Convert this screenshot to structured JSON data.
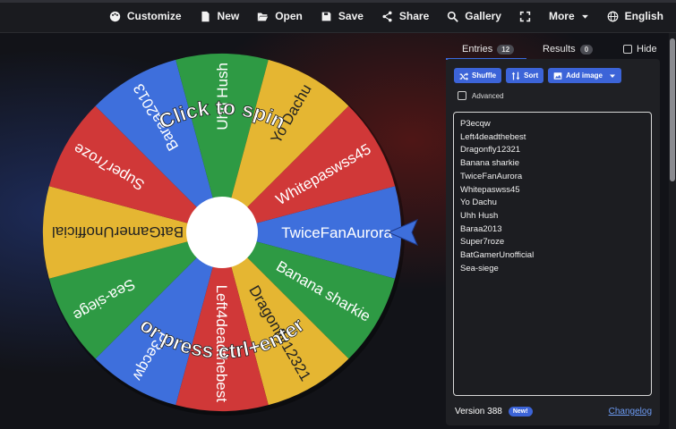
{
  "toolbar": {
    "customize": "Customize",
    "new": "New",
    "open": "Open",
    "save": "Save",
    "share": "Share",
    "gallery": "Gallery",
    "more": "More",
    "language": "English"
  },
  "wheel": {
    "prompt_top": "Click to spin",
    "prompt_bottom": "or press ctrl+enter",
    "segments": [
      {
        "label": "TwiceFanAurora",
        "color": "#3e6fdc"
      },
      {
        "label": "Banana sharkie",
        "color": "#2e9a44"
      },
      {
        "label": "Dragonfly12321",
        "color": "#e5b632"
      },
      {
        "label": "Left4deadthebest",
        "color": "#d03838"
      },
      {
        "label": "P3ecqw",
        "color": "#3e6fdc"
      },
      {
        "label": "Sea-siege",
        "color": "#2e9a44"
      },
      {
        "label": "BatGamerUnofficial",
        "color": "#e5b632"
      },
      {
        "label": "Super7roze",
        "color": "#d03838"
      },
      {
        "label": "Baraa2013",
        "color": "#3e6fdc"
      },
      {
        "label": "Uhh Hush",
        "color": "#2e9a44"
      },
      {
        "label": "Yo Dachu",
        "color": "#e5b632"
      },
      {
        "label": "Whitepaswss45",
        "color": "#d03838"
      }
    ],
    "pointer_color": "#3e6fdc"
  },
  "panel": {
    "tab_entries": "Entries",
    "entries_count": "12",
    "tab_results": "Results",
    "results_count": "0",
    "hide": "Hide",
    "shuffle": "Shuffle",
    "sort": "Sort",
    "add_image": "Add image",
    "advanced": "Advanced",
    "entries": [
      "P3ecqw",
      "Left4deadthebest",
      "Dragonfly12321",
      "Banana sharkie",
      "TwiceFanAurora",
      "Whitepaswss45",
      "Yo Dachu",
      "Uhh Hush",
      "Baraa2013",
      "Super7roze",
      "BatGamerUnofficial",
      "Sea-siege"
    ],
    "version": "Version 388",
    "new_badge": "New!",
    "changelog": "Changelog"
  }
}
